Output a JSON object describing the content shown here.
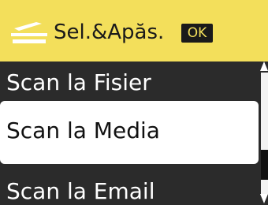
{
  "header": {
    "title": "Sel.&Apăs.",
    "ok_label": "OK"
  },
  "menu": {
    "items": [
      {
        "label": "Scan la Fisier"
      },
      {
        "label": "Scan la Media"
      },
      {
        "label": "Scan la Email"
      }
    ],
    "selected": 1
  },
  "colors": {
    "header_bg": "#f3df5b",
    "list_bg": "#2b2b2b",
    "selected_bg": "#ffffff"
  },
  "icons": {
    "header": "scanner-icon",
    "scroll_up": "scroll-up-arrow-icon",
    "scroll_down": "scroll-down-arrow-icon"
  }
}
